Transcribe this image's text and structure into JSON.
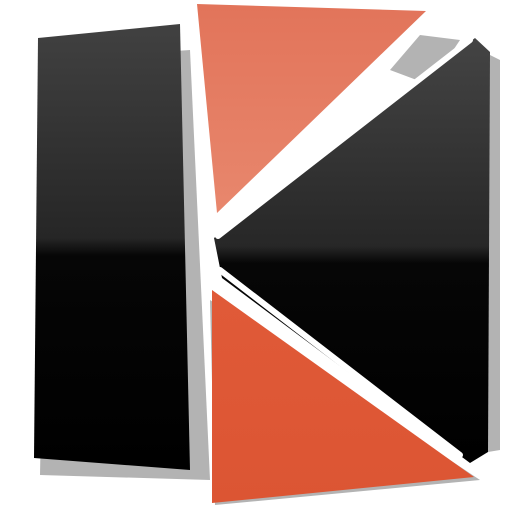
{
  "logo": {
    "name": "k-shard-logo",
    "colors": {
      "background": "#ffffff",
      "shadow": "#b3b3b3",
      "dark_top": "#3a3a3a",
      "dark_mid": "#2a2a2a",
      "dark_bottom": "#050505",
      "orange_light": "#e6836a",
      "orange_dark": "#dc5533",
      "gap": "#ffffff"
    }
  }
}
